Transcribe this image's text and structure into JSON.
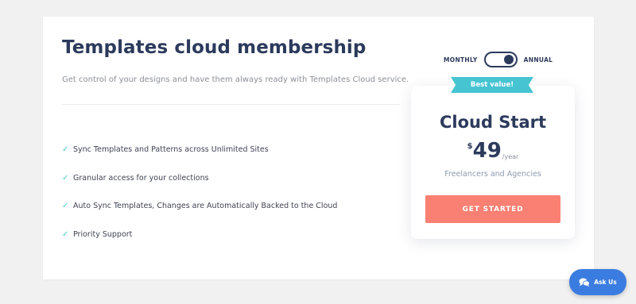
{
  "header": {
    "title": "Templates cloud membership",
    "subtitle": "Get control of your designs and have them always ready with Templates Cloud service."
  },
  "features": [
    "Sync Templates and Patterns across Unlimited Sites",
    "Granular access for your collections",
    "Auto Sync Templates, Changes are Automatically Backed to the Cloud",
    "Priority Support"
  ],
  "billing_toggle": {
    "left_label": "MONTHLY",
    "right_label": "ANNUAL",
    "selected": "ANNUAL"
  },
  "plan": {
    "ribbon": "Best value!",
    "name": "Cloud Start",
    "currency": "$",
    "price": "49",
    "period": "/year",
    "audience": "Freelancers and Agencies",
    "cta_label": "GET STARTED"
  },
  "chat": {
    "label": "Ask Us"
  },
  "colors": {
    "accent": "#46c4d2",
    "cta": "#f98072",
    "navy": "#2c3a5c",
    "chat": "#3b7ce0"
  }
}
